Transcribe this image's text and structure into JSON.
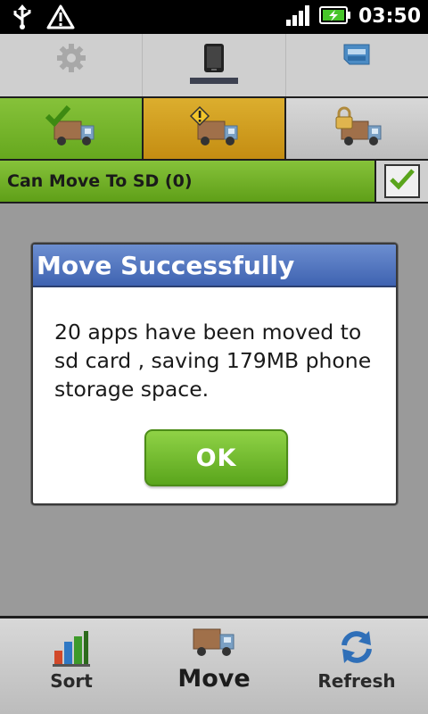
{
  "status_bar": {
    "time": "03:50",
    "icons": [
      "usb-icon",
      "warning-icon",
      "signal-icon",
      "battery-charging-icon"
    ]
  },
  "top_tabs": [
    {
      "name": "settings",
      "icon": "gear-icon",
      "selected": false
    },
    {
      "name": "phone",
      "icon": "phone-icon",
      "selected": true
    },
    {
      "name": "sd-card",
      "icon": "micro-sd-card-icon",
      "selected": false
    }
  ],
  "filters": [
    {
      "name": "can-move",
      "icon": "truck-check-icon",
      "color": "#77b52b"
    },
    {
      "name": "warning",
      "icon": "truck-warning-icon",
      "color": "#d39f22"
    },
    {
      "name": "locked",
      "icon": "truck-lock-icon",
      "color": "#c9c9c9"
    }
  ],
  "list_header": {
    "label": "Can Move To SD (0)",
    "checked": true
  },
  "dialog": {
    "title": "Move Successfully",
    "message": "20 apps have been moved to sd card , saving 179MB phone storage space.",
    "ok_label": "OK"
  },
  "bottom_bar": {
    "items": [
      {
        "label": "Sort",
        "icon": "bar-chart-icon"
      },
      {
        "label": "Move",
        "icon": "truck-icon"
      },
      {
        "label": "Refresh",
        "icon": "refresh-icon"
      }
    ]
  },
  "colors": {
    "accent_green": "#6aab22",
    "dialog_title_blue": "#4a6fbd",
    "warning_orange": "#d39f22"
  }
}
